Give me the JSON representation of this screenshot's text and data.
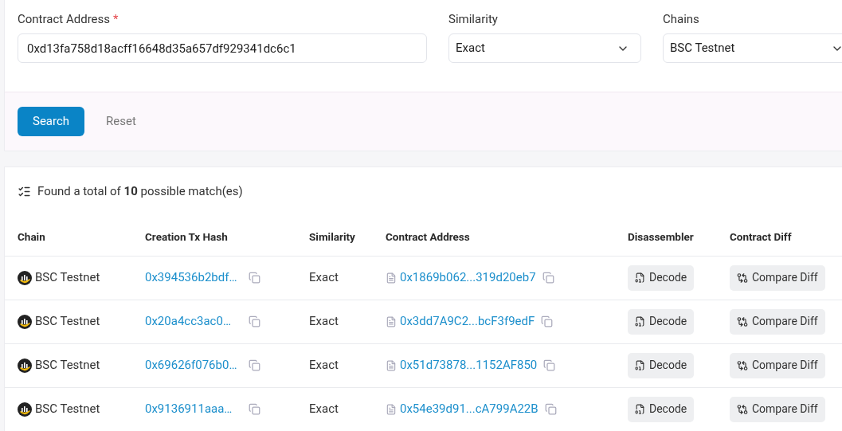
{
  "form": {
    "fields": [
      {
        "kind": "text",
        "label": "Contract Address",
        "required_mark": "*",
        "value": "0xd13fa758d18acff16648d35a657df929341dc6c1"
      },
      {
        "kind": "select",
        "label": "Similarity",
        "value": "Exact"
      },
      {
        "kind": "select",
        "label": "Chains",
        "value": "BSC Testnet"
      }
    ],
    "buttons": [
      {
        "label": "Search",
        "kind": "primary"
      },
      {
        "label": "Reset",
        "kind": "text"
      }
    ]
  },
  "results": {
    "summary_before": "Found a total of ",
    "count": "10",
    "summary_after": " possible match(es)",
    "columns": [
      "Chain",
      "Creation Tx Hash",
      "Similarity",
      "Contract Address",
      "Disassembler",
      "Contract Diff"
    ],
    "rows": [
      {
        "chain": "BSC Testnet",
        "tx_hash": "0x394536b2bdf…",
        "similarity": "Exact",
        "address": "0x1869b062...319d20eb7",
        "decode": "Decode",
        "diff": "Compare Diff"
      },
      {
        "chain": "BSC Testnet",
        "tx_hash": "0x20a4cc3ac0…",
        "similarity": "Exact",
        "address": "0x3dd7A9C2...bcF3f9edF",
        "decode": "Decode",
        "diff": "Compare Diff"
      },
      {
        "chain": "BSC Testnet",
        "tx_hash": "0x69626f076b0…",
        "similarity": "Exact",
        "address": "0x51d73878...1152AF850",
        "decode": "Decode",
        "diff": "Compare Diff"
      },
      {
        "chain": "BSC Testnet",
        "tx_hash": "0x9136911aaa…",
        "similarity": "Exact",
        "address": "0x54e39d91...cA799A22B",
        "decode": "Decode",
        "diff": "Compare Diff"
      }
    ]
  }
}
